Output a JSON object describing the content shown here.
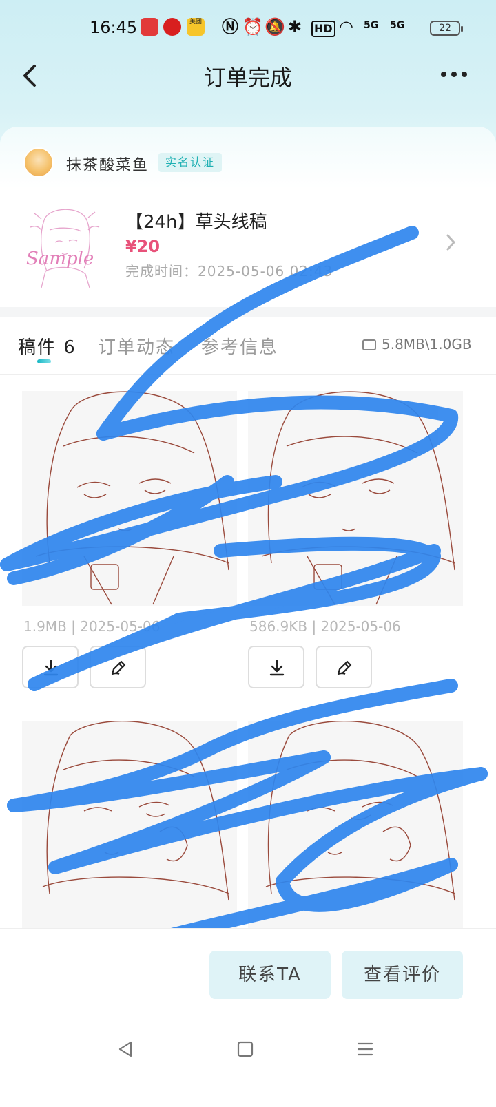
{
  "status_bar": {
    "time": "16:45",
    "app_icons": [
      "news-app-icon",
      "metro-app-icon",
      "meituan-app-icon"
    ],
    "meituan_label": "美团",
    "icons": [
      "nfc-icon",
      "alarm-icon",
      "mute-icon",
      "bluetooth-icon",
      "hd-icon",
      "wifi-icon",
      "signal-5g-icon",
      "signal-5g-icon"
    ],
    "hd_label": "HD",
    "network_label": "5G",
    "battery": "22"
  },
  "nav": {
    "title": "订单完成"
  },
  "seller": {
    "name": "抹茶酸菜鱼",
    "badge": "实名认证"
  },
  "product": {
    "title": "【24h】草头线稿",
    "price": "¥20",
    "completed_label": "完成时间：2025-05-06 02:43",
    "thumb_watermark": "Sample"
  },
  "tabs": [
    {
      "label": "稿件 6",
      "active": true
    },
    {
      "label": "订单动态",
      "active": false
    },
    {
      "label": "参考信息",
      "active": false
    }
  ],
  "storage": "5.8MB\\1.0GB",
  "files": [
    {
      "meta": "1.9MB | 2025-05-06"
    },
    {
      "meta": "586.9KB | 2025-05-06"
    },
    {
      "meta": ""
    },
    {
      "meta": ""
    }
  ],
  "actions": {
    "contact": "联系TA",
    "review": "查看评价"
  },
  "colors": {
    "accent": "#1fb0b3",
    "price": "#e8527a",
    "scribble": "#2f86ee"
  }
}
